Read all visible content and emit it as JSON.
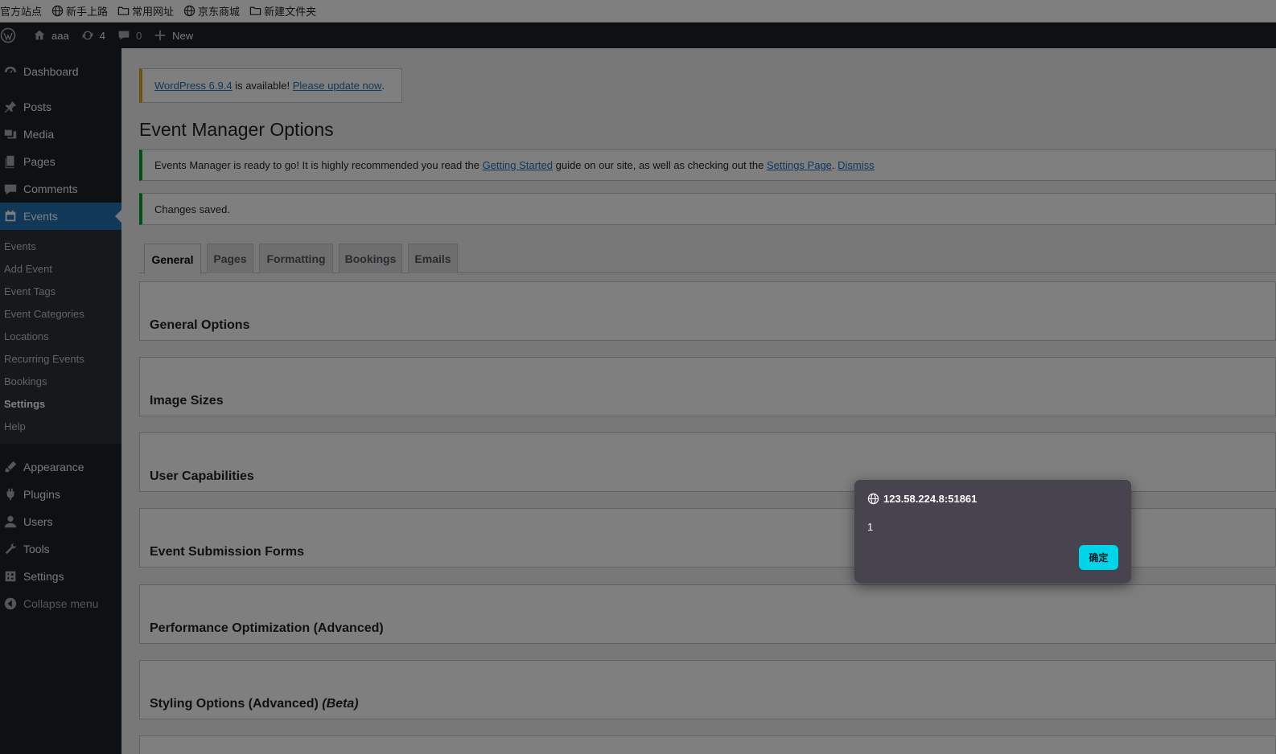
{
  "bookmarks": [
    {
      "label": "官方站点",
      "icon": "none"
    },
    {
      "label": "新手上路",
      "icon": "globe-icon"
    },
    {
      "label": "常用网址",
      "icon": "folder-icon"
    },
    {
      "label": "京东商城",
      "icon": "globe-icon"
    },
    {
      "label": "新建文件夹",
      "icon": "folder-icon"
    }
  ],
  "adminbar": {
    "site_name": "aaa",
    "updates_count": "4",
    "comments_count": "0",
    "new_label": "New"
  },
  "sidebar": {
    "items_top": [
      {
        "label": "Dashboard",
        "icon": "dashboard-icon"
      },
      {
        "label": "Posts",
        "icon": "pin-icon"
      },
      {
        "label": "Media",
        "icon": "media-icon"
      },
      {
        "label": "Pages",
        "icon": "pages-icon"
      },
      {
        "label": "Comments",
        "icon": "comment-icon"
      },
      {
        "label": "Events",
        "icon": "calendar-icon"
      }
    ],
    "submenu": [
      "Events",
      "Add Event",
      "Event Tags",
      "Event Categories",
      "Locations",
      "Recurring Events",
      "Bookings",
      "Settings",
      "Help"
    ],
    "items_bottom": [
      {
        "label": "Appearance",
        "icon": "brush-icon"
      },
      {
        "label": "Plugins",
        "icon": "plugin-icon"
      },
      {
        "label": "Users",
        "icon": "user-icon"
      },
      {
        "label": "Tools",
        "icon": "wrench-icon"
      },
      {
        "label": "Settings",
        "icon": "settings-icon"
      },
      {
        "label": "Collapse menu",
        "icon": "collapse-icon"
      }
    ]
  },
  "main": {
    "update_nag": {
      "link1": "WordPress 6.9.4",
      "middle": " is available! ",
      "link2": "Please update now",
      "end": "."
    },
    "page_title": "Event Manager Options",
    "notice1": {
      "text1": "Events Manager is ready to go! It is highly recommended you read the ",
      "link1": "Getting Started",
      "text2": " guide on our site, as well as checking out the ",
      "link2": "Settings Page",
      "text3": ". ",
      "link3": "Dismiss"
    },
    "notice2": "Changes saved.",
    "tabs": [
      "General",
      "Pages",
      "Formatting",
      "Bookings",
      "Emails"
    ],
    "sections": [
      "General Options",
      "Image Sizes",
      "User Capabilities",
      "Event Submission Forms",
      "Performance Optimization (Advanced)",
      "Styling Options (Advanced)"
    ],
    "sections_beta_suffix": "(Beta)"
  },
  "dialog": {
    "origin": "123.58.224.8:51861",
    "message": "1",
    "ok_label": "确定"
  },
  "colors": {
    "admin_dark": "#1d2327",
    "active_blue": "#2271b1",
    "notice_green": "#00a32a",
    "nag_yellow": "#dba617",
    "dialog_bg": "#47434f",
    "dialog_button": "#00d4e8"
  }
}
